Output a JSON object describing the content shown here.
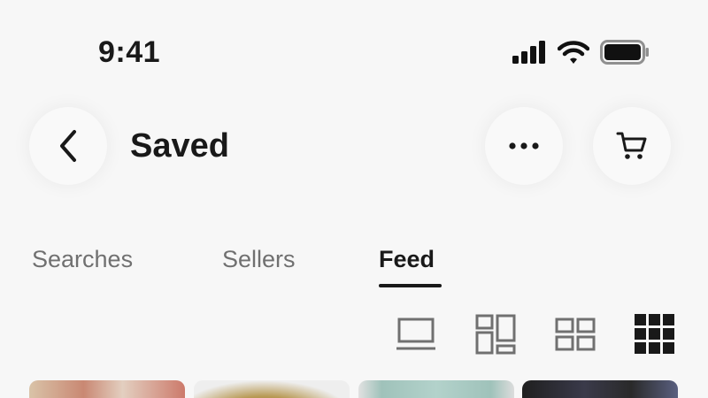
{
  "status_bar": {
    "time": "9:41",
    "icons": [
      "cellular-signal-icon",
      "wifi-icon",
      "battery-icon"
    ]
  },
  "header": {
    "title": "Saved",
    "back_icon": "chevron-left-icon",
    "more_icon": "more-horizontal-icon",
    "cart_icon": "cart-icon"
  },
  "tabs": [
    {
      "label": "Searches",
      "selected": false
    },
    {
      "label": "Sellers",
      "selected": false
    },
    {
      "label": "Feed",
      "selected": true
    }
  ],
  "view_options": [
    {
      "icon": "list-view-icon",
      "selected": false
    },
    {
      "icon": "masonry-view-icon",
      "selected": false
    },
    {
      "icon": "grid-2-view-icon",
      "selected": false
    },
    {
      "icon": "grid-3-view-icon",
      "selected": true
    }
  ],
  "colors": {
    "background": "#f7f7f7",
    "text_primary": "#191919",
    "text_secondary": "#707070",
    "icon_inactive": "#707070"
  }
}
